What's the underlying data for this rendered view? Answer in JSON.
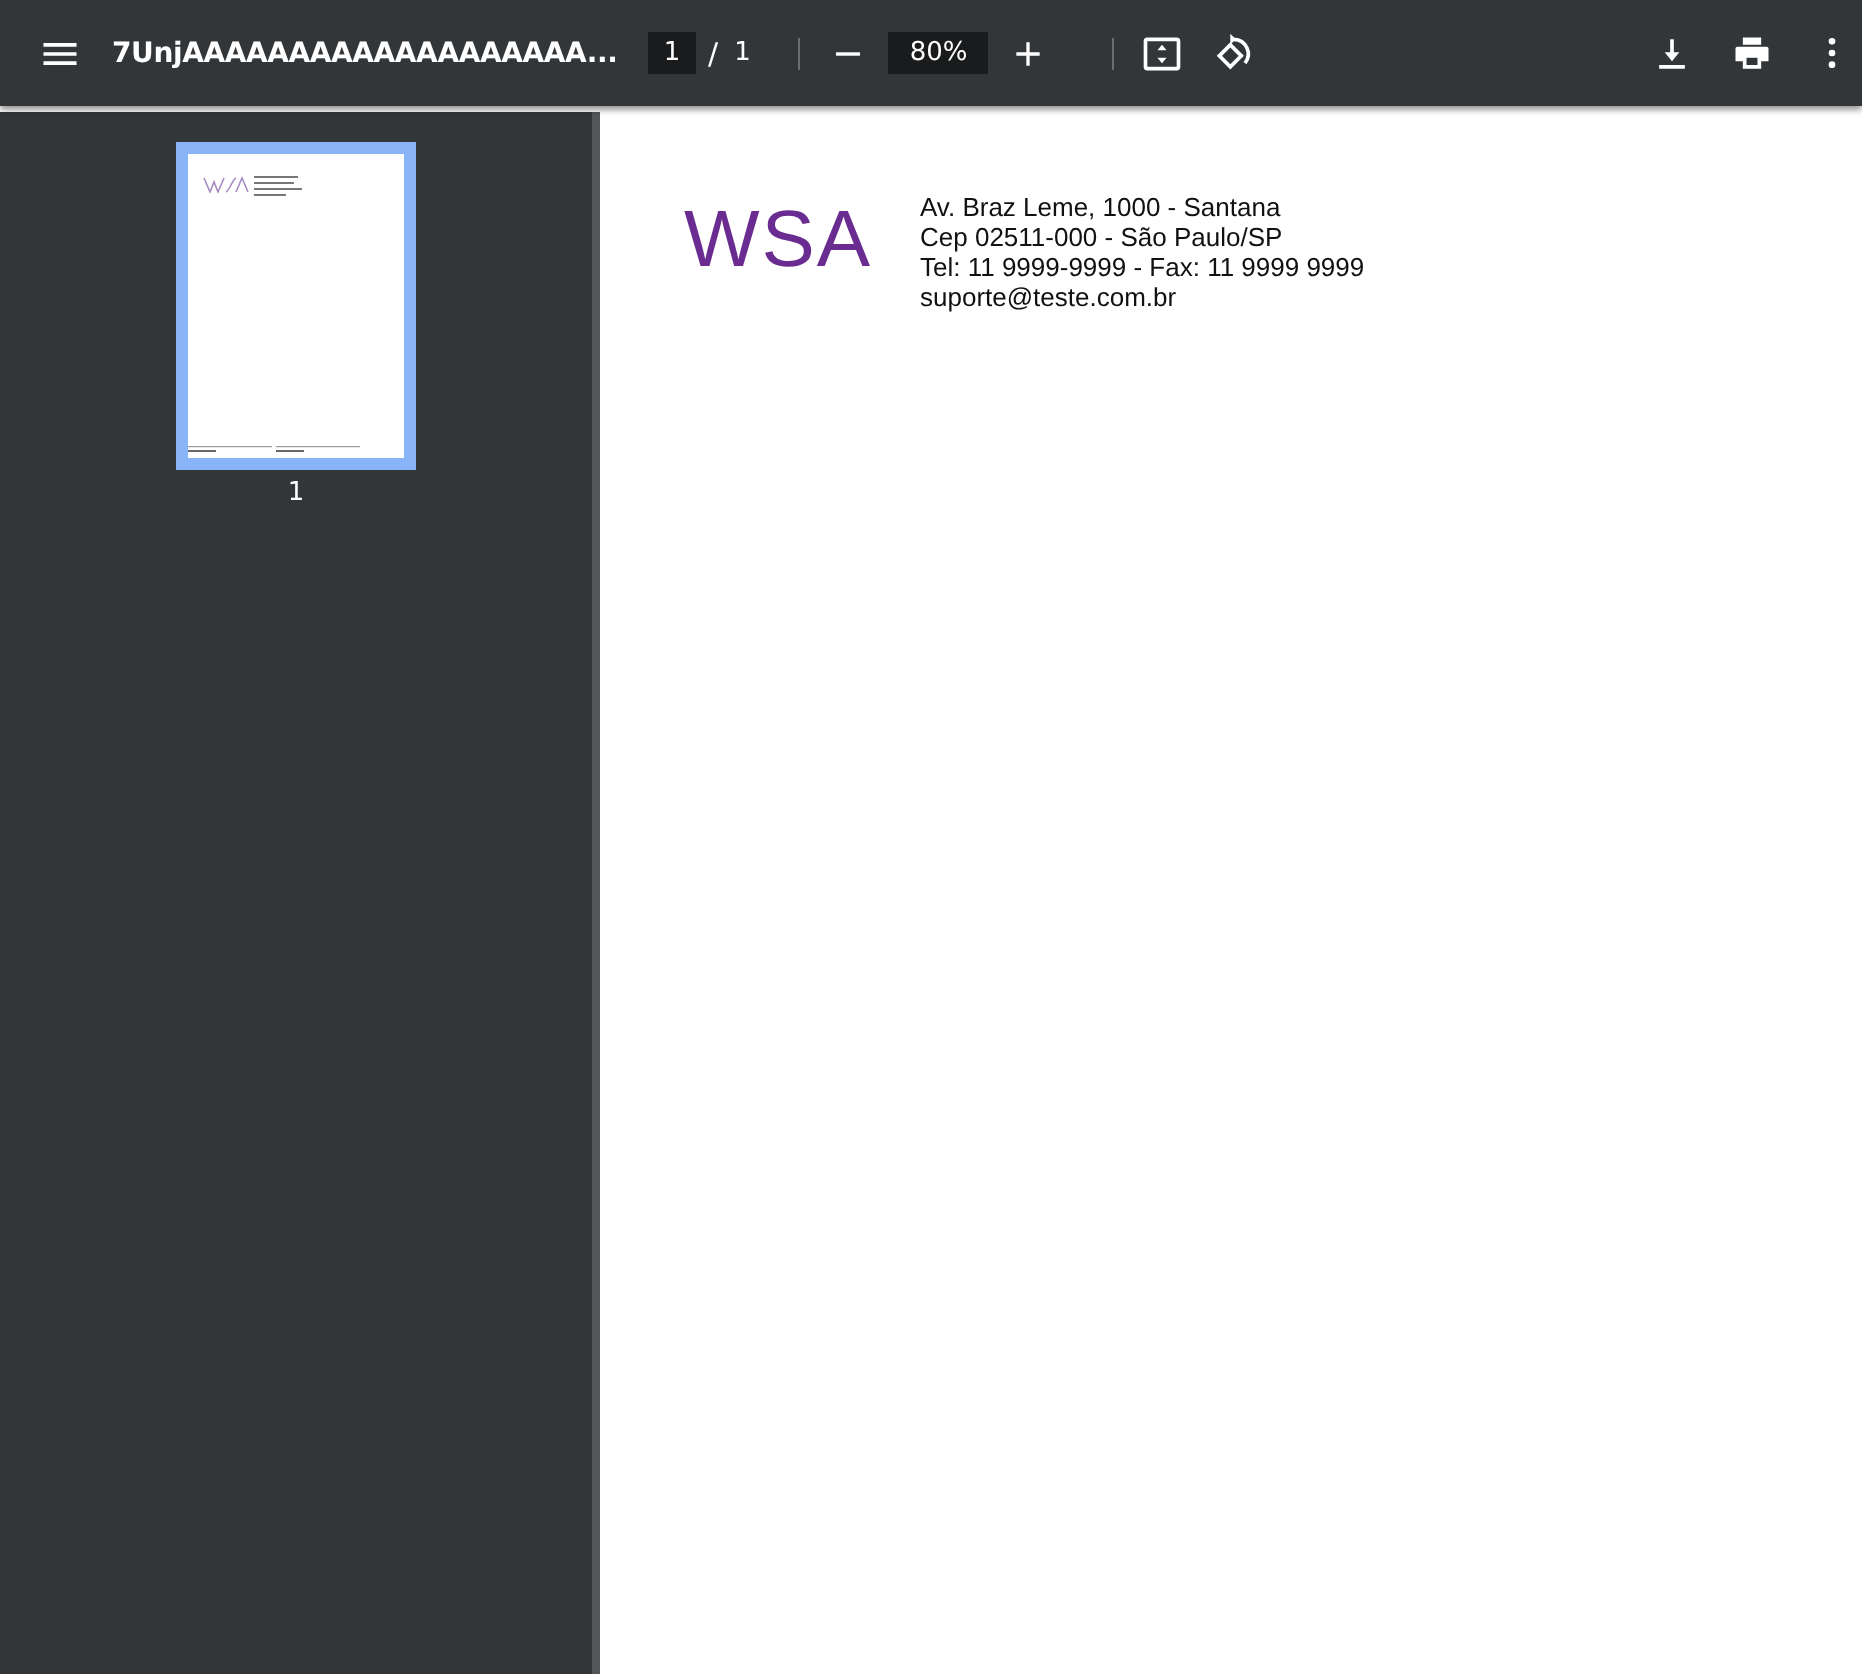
{
  "toolbar": {
    "title": "7UnjAAAAAAAAAAAAAAAAAAA...",
    "page_current": "1",
    "page_separator": "/",
    "page_total": "1",
    "zoom": "80%"
  },
  "thumbnails": [
    {
      "label": "1",
      "selected": true
    }
  ],
  "document": {
    "logo": "WSA",
    "address_lines": [
      "Av. Braz Leme, 1000 - Santana",
      "Cep 02511-000 - São Paulo/SP",
      "Tel: 11 9999-9999 - Fax: 11 9999 9999",
      "suporte@teste.com.br"
    ]
  }
}
